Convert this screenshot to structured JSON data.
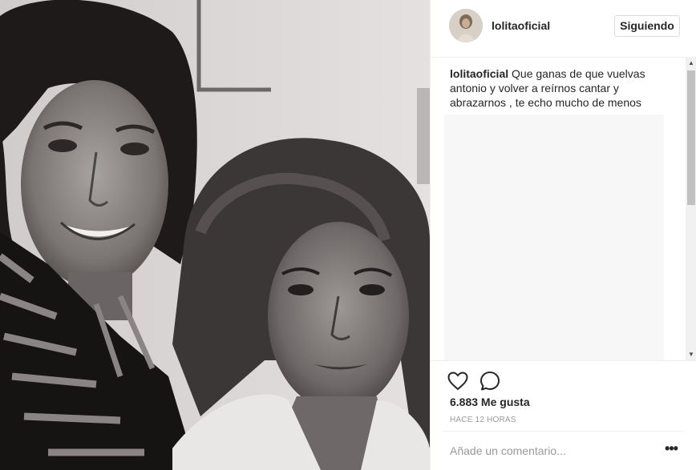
{
  "post": {
    "header": {
      "username": "lolitaoficial",
      "follow_label": "Siguiendo"
    },
    "caption": {
      "username": "lolitaoficial",
      "text": "Que ganas de que vuelvas antonio y volver a reírnos cantar y abrazarnos , te echo mucho de menos"
    },
    "likes": "6.883 Me gusta",
    "timestamp": "HACE 12 HORAS",
    "add_comment": {
      "placeholder": "Añade un comentario..."
    },
    "more_label": "•••",
    "icons": {
      "like": "heart-icon",
      "comment": "comment-bubble-icon",
      "more": "more-options-icon"
    },
    "colors": {
      "text": "#262626",
      "secondary": "#999999",
      "border": "#efefef"
    }
  }
}
